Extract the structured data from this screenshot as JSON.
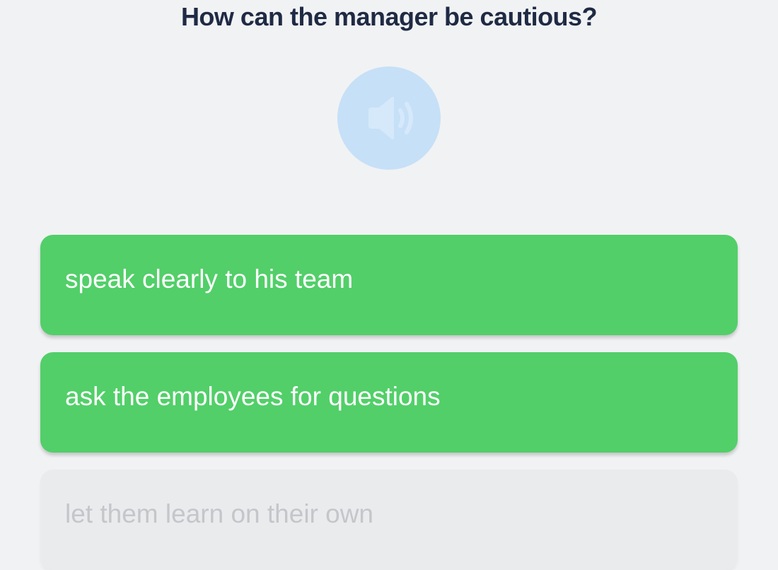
{
  "question": {
    "text": "How can the manager be cautious?"
  },
  "audio_button": {
    "icon": "speaker-icon",
    "background_color": "#c6e0f7",
    "icon_color": "#d6e9fa"
  },
  "answers": [
    {
      "label": "speak clearly to his team",
      "state": "active",
      "color": "#52cf69"
    },
    {
      "label": "ask the employees for questions",
      "state": "active",
      "color": "#52cf69"
    },
    {
      "label": "let them learn on their own",
      "state": "disabled",
      "color": "#eaebed"
    }
  ],
  "colors": {
    "page_background": "#f1f2f4",
    "question_text": "#1f2a44",
    "answer_active_text": "#ffffff",
    "answer_disabled_text": "#c4c6ca"
  }
}
